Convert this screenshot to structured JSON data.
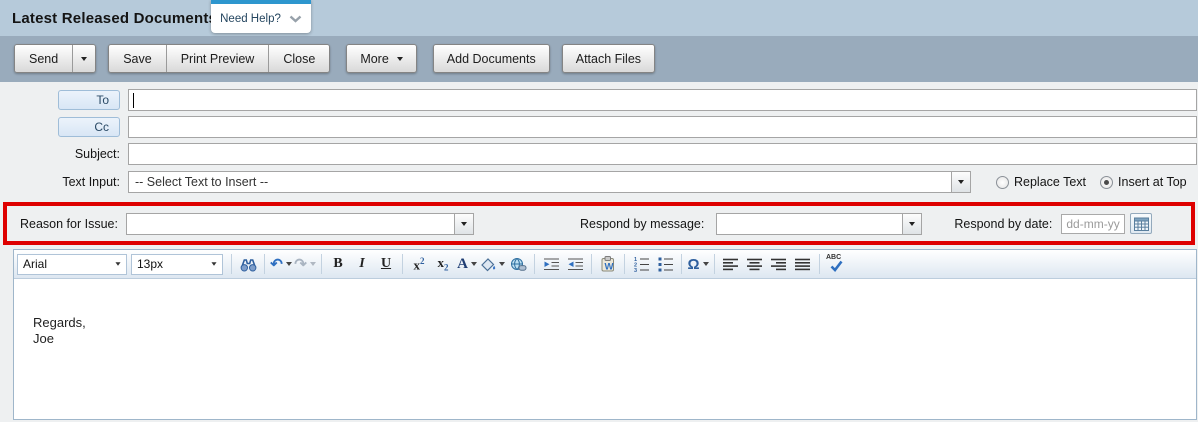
{
  "header": {
    "title": "Latest Released Documents",
    "help_label": "Need Help?"
  },
  "toolbar": {
    "send": "Send",
    "save": "Save",
    "print_preview": "Print Preview",
    "close": "Close",
    "more": "More",
    "add_documents": "Add Documents",
    "attach_files": "Attach Files"
  },
  "form": {
    "to_label": "To",
    "to_value": "",
    "cc_label": "Cc",
    "cc_value": "",
    "subject_label": "Subject:",
    "subject_value": "",
    "text_input_label": "Text Input:",
    "text_insert_selected": "-- Select Text to Insert --",
    "replace_text_label": "Replace Text",
    "replace_text_checked": false,
    "insert_at_top_label": "Insert at Top",
    "insert_at_top_checked": true
  },
  "issue_row": {
    "reason_label": "Reason for Issue:",
    "reason_value": "",
    "respond_message_label": "Respond by message:",
    "respond_message_value": "",
    "respond_date_label": "Respond by date:",
    "respond_date_value": "",
    "respond_date_placeholder": "dd-mm-yy"
  },
  "editor": {
    "font_family": "Arial",
    "font_size": "13px",
    "body_lines": [
      "Regards,",
      "Joe"
    ]
  },
  "icons": {
    "undo": "↶",
    "redo": "↷",
    "bold": "B",
    "italic": "I",
    "underline": "U",
    "sup_base": "x",
    "sup_mark": "2",
    "sub_base": "x",
    "sub_mark": "2",
    "font_color": "A",
    "omega": "Ω",
    "spellcheck": "ABC",
    "paste_word": "W"
  },
  "colors": {
    "header_bg": "#b6cada",
    "actionbar_bg": "#99abbc",
    "form_bg": "#eef0f1",
    "highlight_border": "#de0000",
    "help_tab_accent": "#2d96ce"
  }
}
